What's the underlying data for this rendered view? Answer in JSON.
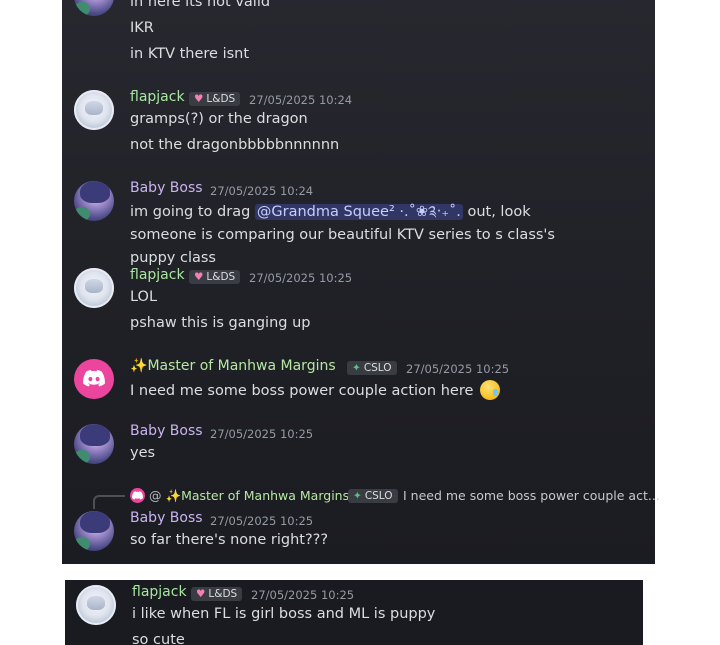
{
  "messages": {
    "top_line_1": "in here its not valid",
    "top_line_2": "IKR",
    "top_line_3": "in KTV there isnt",
    "m1": {
      "author": "flapjack",
      "tag": "L&DS",
      "time": "27/05/2025 10:24",
      "line1": "gramps(?) or the dragon",
      "line2": "not the dragonbbbbbnnnnnn"
    },
    "m2": {
      "author": "Baby Boss",
      "time": "27/05/2025 10:24",
      "before": "im going to drag ",
      "mention": "@Grandma Squee² ·.˚❀༉‧₊˚.",
      "after": " out, look someone is comparing our beautiful KTV series to s class's puppy class"
    },
    "m3": {
      "author": "flapjack",
      "tag": "L&DS",
      "time": "27/05/2025 10:25",
      "line1": "LOL",
      "line2": "pshaw this is ganging up"
    },
    "m4": {
      "sparkle": "✨",
      "author": "Master of Manhwa Margins",
      "tag": "CSLO",
      "time": "27/05/2025 10:25",
      "line1": "I need me some boss power couple action here"
    },
    "m5": {
      "author": "Baby Boss",
      "time": "27/05/2025 10:25",
      "line1": "yes"
    },
    "m6": {
      "reply_at": "@",
      "reply_sparkle": "✨",
      "reply_author": "Master of Manhwa Margins",
      "reply_tag": "CSLO",
      "reply_text": "I need me some boss power couple act...",
      "author": "Baby Boss",
      "time": "27/05/2025 10:25",
      "line1": "so far there's none right???"
    },
    "m7": {
      "author": "flapjack",
      "tag": "L&DS",
      "time": "27/05/2025 10:25",
      "line1": "i like when FL is girl boss and ML is puppy",
      "line2": "so cute"
    }
  },
  "colors": {
    "background": "#1f2026",
    "flapjack_name": "#a8e6a1",
    "babyboss_name": "#c9b4ef",
    "master_name": "#b6e7a3",
    "discord_avatar": "#eb459e",
    "mention_bg": "#5865f24d"
  },
  "icons": {
    "flapjack_tag": "heart-icon",
    "master_tag": "plus-sparkle-icon",
    "avatar_discord": "discord-logo-icon",
    "emoji": "pleading-tear-emoji-icon"
  }
}
